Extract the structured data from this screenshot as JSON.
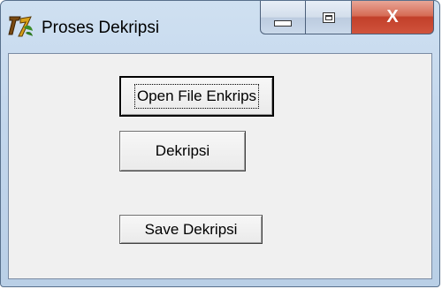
{
  "window": {
    "title": "Proses Dekripsi",
    "icon": "delphi-app-icon"
  },
  "caption_buttons": {
    "minimize": "minimize-icon",
    "maximize": "maximize-icon",
    "close_label": "X"
  },
  "buttons": {
    "open": "Open File Enkrips",
    "decrypt": "Dekripsi",
    "save": "Save Dekripsi"
  },
  "colors": {
    "frame": "#c2d6ec",
    "client": "#f0f0f0",
    "close_button": "#c2402a"
  }
}
